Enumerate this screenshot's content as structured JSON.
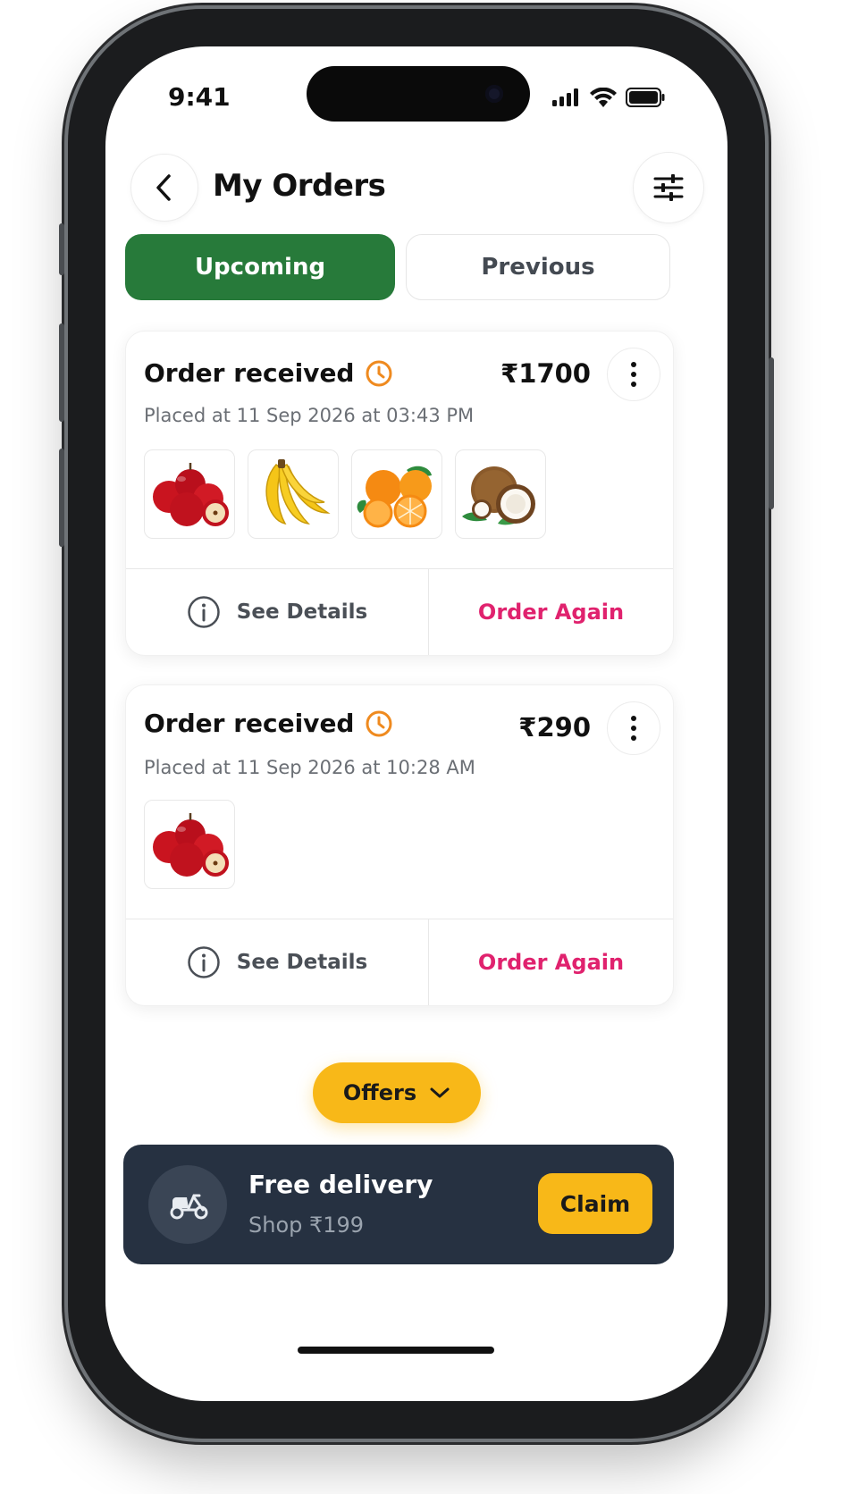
{
  "status_bar": {
    "time": "9:41",
    "icons": [
      "signal-icon",
      "wifi-icon",
      "battery-icon"
    ]
  },
  "header": {
    "back_icon": "chevron-left-icon",
    "title": "My Orders",
    "filter_icon": "sliders-icon"
  },
  "tabs": [
    {
      "label": "Upcoming",
      "active": true
    },
    {
      "label": "Previous",
      "active": false
    }
  ],
  "orders": [
    {
      "status": "Order received",
      "status_icon": "clock-icon",
      "price": "₹1700",
      "placed": "Placed at 11 Sep 2026 at 03:43 PM",
      "items": [
        "apples",
        "bananas",
        "oranges",
        "coconut"
      ],
      "see_details": "See Details",
      "order_again": "Order Again"
    },
    {
      "status": "Order received",
      "status_icon": "clock-icon",
      "price": "₹290",
      "placed": "Placed at 11 Sep 2026 at 10:28 AM",
      "items": [
        "apples"
      ],
      "see_details": "See Details",
      "order_again": "Order Again"
    }
  ],
  "offers": {
    "label": "Offers",
    "icon": "chevron-down-icon"
  },
  "promo": {
    "icon": "scooter-icon",
    "title": "Free delivery",
    "subtitle": "Shop ₹199",
    "button": "Claim"
  },
  "colors": {
    "primary_green": "#277a3a",
    "accent_pink": "#e0226e",
    "accent_yellow": "#f8b818",
    "clock_orange": "#ef8a1f",
    "promo_bg": "#263141"
  }
}
